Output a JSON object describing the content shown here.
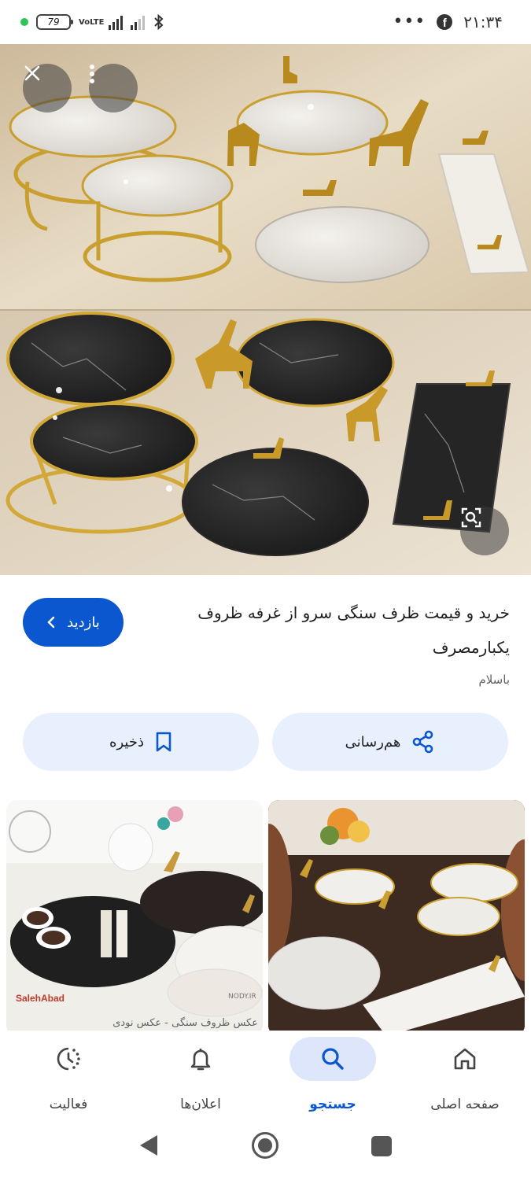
{
  "status_bar": {
    "battery": "79",
    "network_label": "VoLTE",
    "time": "۲۱:۳۴",
    "icons": [
      "green-dot-icon",
      "battery-icon",
      "signal-icon",
      "bluetooth-icon",
      "more-dots-icon",
      "facebook-icon"
    ]
  },
  "image_viewer": {
    "close_icon": "close-icon",
    "menu_icon": "more-vert-icon",
    "lens_icon": "lens-icon"
  },
  "result": {
    "title": "خرید و قیمت ظرف سنگی سرو از غرفه ظروف یکبارمصرف",
    "source": "باسلام",
    "visit_label": "بازدید"
  },
  "actions": {
    "share_label": "هم‌رسانی",
    "save_label": "ذخیره"
  },
  "related": {
    "left_caption": "عکس ظروف سنگی - عکس نودی",
    "left_watermark": "SalehAbad",
    "left_watermark2": "NODY.IR"
  },
  "bottom_nav": {
    "items": [
      {
        "label": "صفحه اصلی",
        "icon": "home-icon",
        "active": false
      },
      {
        "label": "جستجو",
        "icon": "search-icon",
        "active": true
      },
      {
        "label": "اعلان‌ها",
        "icon": "bell-icon",
        "active": false
      },
      {
        "label": "فعالیت",
        "icon": "activity-icon",
        "active": false
      }
    ]
  },
  "colors": {
    "accent": "#0b57d0",
    "pill_bg": "#e8f0fe",
    "nav_active_bg": "#dde6fb"
  }
}
